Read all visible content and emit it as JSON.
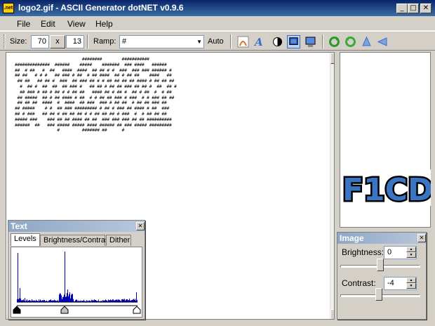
{
  "window": {
    "app_icon_text": ".net",
    "title": "logo2.gif - ASCII Generator dotNET v0.9.6",
    "minimize_glyph": "_",
    "maximize_glyph": "□",
    "close_glyph": "✕"
  },
  "menu": {
    "items": [
      "File",
      "Edit",
      "View",
      "Help"
    ]
  },
  "toolbar": {
    "size_label": "Size:",
    "width_value": "70",
    "times_label": "x",
    "height_value": "13",
    "ramp_label": "Ramp:",
    "ramp_value": "#",
    "auto_label": "Auto",
    "icons": [
      "font-a-icon",
      "text-a-icon",
      "invert-circle-icon",
      "monitor-icon",
      "computer-icon",
      "refresh-green-icon",
      "refresh-green-2-icon",
      "flip-vertical-icon",
      "flip-horizontal-icon"
    ]
  },
  "ascii_output": "                           ########        ###########\n##############  ######    #####    #######  ### ####   ######\n##  # ##   #  ##   ####  ####  ## ## # #  ###  ### ### ###### #\n## ##   # # #   ## ### # ##  # ## ####  ## # ## ##    ####   ##\n ## ##   ## ## #  ###  ## ### ## # # ## ## ## ## #### # ## ## ##\n  #  ## #  ##  ##  ## ### #   ## ## # ## ## ### ## ## #  ##  ## #\n  ## ### # ## # ## # # ## ##   #### ## # ## #  ## # ##  #  # ##\n ## #####  ## # ## #### # ##  # # ## ## ### # ###  # # ### ## ##\n ## ## ##  ####  #  ####  ## ###  ### # ## ##  # ## ## ### ##\n## #####    # #  ## ### ######### # ## # ### ## #### # ##  ###\n## # ###   ## ## # ## ## ## # # ## ## ## # ###  #  # ## ## ##\n##### ###    ### ## ## #### ## ##  ### ### ### ## ## ##########\n######  ##   ### ##### ##### #### ###### ## ### ##### #########\n                 #         ####### ##      #",
  "scrollbar": {
    "up_glyph": "▲",
    "down_glyph": "▼"
  },
  "preview": {
    "logo_text": "F1CD",
    "logo_color": "#3a75c4"
  },
  "text_panel": {
    "title": "Text",
    "close_glyph": "✕",
    "tabs": [
      "Levels",
      "Brightness/Contrast",
      "Dither"
    ],
    "active_tab": "Levels",
    "histogram_color": "#0000b4"
  },
  "image_panel": {
    "title": "Image",
    "close_glyph": "✕",
    "brightness_label": "Brightness:",
    "brightness_value": "0",
    "contrast_label": "Contrast:",
    "contrast_value": "-4"
  }
}
